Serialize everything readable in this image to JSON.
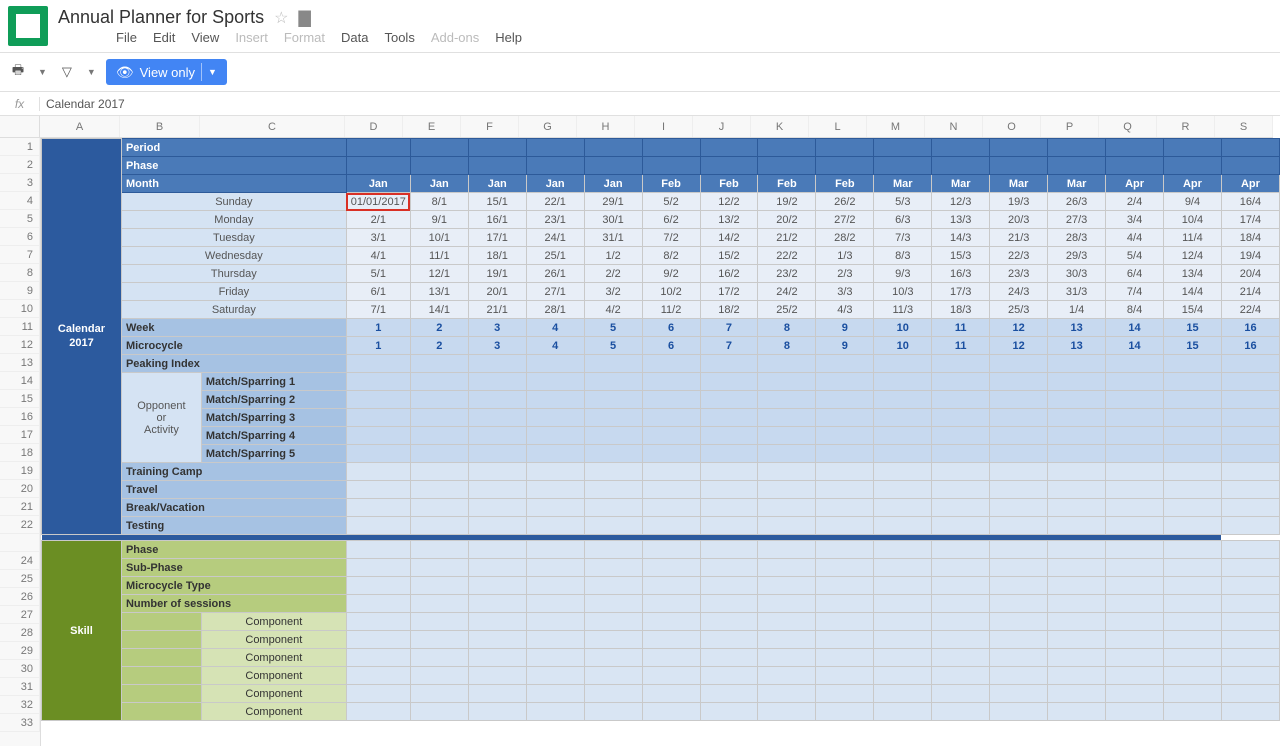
{
  "doc": {
    "title": "Annual Planner for Sports"
  },
  "menu": {
    "file": "File",
    "edit": "Edit",
    "view": "View",
    "insert": "Insert",
    "format": "Format",
    "data": "Data",
    "tools": "Tools",
    "addons": "Add-ons",
    "help": "Help"
  },
  "toolbar": {
    "view_only": "View only"
  },
  "fx": {
    "value": "Calendar 2017"
  },
  "cols": [
    "A",
    "B",
    "C",
    "D",
    "E",
    "F",
    "G",
    "H",
    "I",
    "J",
    "K",
    "L",
    "M",
    "N",
    "O",
    "P",
    "Q",
    "R",
    "S"
  ],
  "rows_visible": [
    "1",
    "2",
    "3",
    "4",
    "5",
    "6",
    "7",
    "8",
    "9",
    "10",
    "11",
    "12",
    "13",
    "14",
    "15",
    "16",
    "17",
    "18",
    "19",
    "20",
    "21",
    "22",
    "",
    "24",
    "25",
    "26",
    "27",
    "28",
    "29",
    "30",
    "31",
    "32",
    "33"
  ],
  "side": {
    "calendar": "Calendar 2017",
    "skill": "Skill"
  },
  "labels": {
    "period": "Period",
    "phase": "Phase",
    "month": "Month",
    "days": [
      "Sunday",
      "Monday",
      "Tuesday",
      "Wednesday",
      "Thursday",
      "Friday",
      "Saturday"
    ],
    "week": "Week",
    "microcycle": "Microcycle",
    "peaking": "Peaking Index",
    "opponent": "Opponent or Activity",
    "matches": [
      "Match/Sparring 1",
      "Match/Sparring 2",
      "Match/Sparring 3",
      "Match/Sparring 4",
      "Match/Sparring 5"
    ],
    "training_camp": "Training Camp",
    "travel": "Travel",
    "break": "Break/Vacation",
    "testing": "Testing",
    "skill_rows": [
      "Phase",
      "Sub-Phase",
      "Microcycle Type",
      "Number of sessions"
    ],
    "component": "Component"
  },
  "months": [
    "Jan",
    "Jan",
    "Jan",
    "Jan",
    "Jan",
    "Feb",
    "Feb",
    "Feb",
    "Feb",
    "Mar",
    "Mar",
    "Mar",
    "Mar",
    "Apr",
    "Apr",
    "Apr"
  ],
  "dates": {
    "Sunday": [
      "01/01/2017",
      "8/1",
      "15/1",
      "22/1",
      "29/1",
      "5/2",
      "12/2",
      "19/2",
      "26/2",
      "5/3",
      "12/3",
      "19/3",
      "26/3",
      "2/4",
      "9/4",
      "16/4"
    ],
    "Monday": [
      "2/1",
      "9/1",
      "16/1",
      "23/1",
      "30/1",
      "6/2",
      "13/2",
      "20/2",
      "27/2",
      "6/3",
      "13/3",
      "20/3",
      "27/3",
      "3/4",
      "10/4",
      "17/4"
    ],
    "Tuesday": [
      "3/1",
      "10/1",
      "17/1",
      "24/1",
      "31/1",
      "7/2",
      "14/2",
      "21/2",
      "28/2",
      "7/3",
      "14/3",
      "21/3",
      "28/3",
      "4/4",
      "11/4",
      "18/4"
    ],
    "Wednesday": [
      "4/1",
      "11/1",
      "18/1",
      "25/1",
      "1/2",
      "8/2",
      "15/2",
      "22/2",
      "1/3",
      "8/3",
      "15/3",
      "22/3",
      "29/3",
      "5/4",
      "12/4",
      "19/4"
    ],
    "Thursday": [
      "5/1",
      "12/1",
      "19/1",
      "26/1",
      "2/2",
      "9/2",
      "16/2",
      "23/2",
      "2/3",
      "9/3",
      "16/3",
      "23/3",
      "30/3",
      "6/4",
      "13/4",
      "20/4"
    ],
    "Friday": [
      "6/1",
      "13/1",
      "20/1",
      "27/1",
      "3/2",
      "10/2",
      "17/2",
      "24/2",
      "3/3",
      "10/3",
      "17/3",
      "24/3",
      "31/3",
      "7/4",
      "14/4",
      "21/4"
    ],
    "Saturday": [
      "7/1",
      "14/1",
      "21/1",
      "28/1",
      "4/2",
      "11/2",
      "18/2",
      "25/2",
      "4/3",
      "11/3",
      "18/3",
      "25/3",
      "1/4",
      "8/4",
      "15/4",
      "22/4"
    ]
  },
  "weeks": [
    "1",
    "2",
    "3",
    "4",
    "5",
    "6",
    "7",
    "8",
    "9",
    "10",
    "11",
    "12",
    "13",
    "14",
    "15",
    "16"
  ]
}
